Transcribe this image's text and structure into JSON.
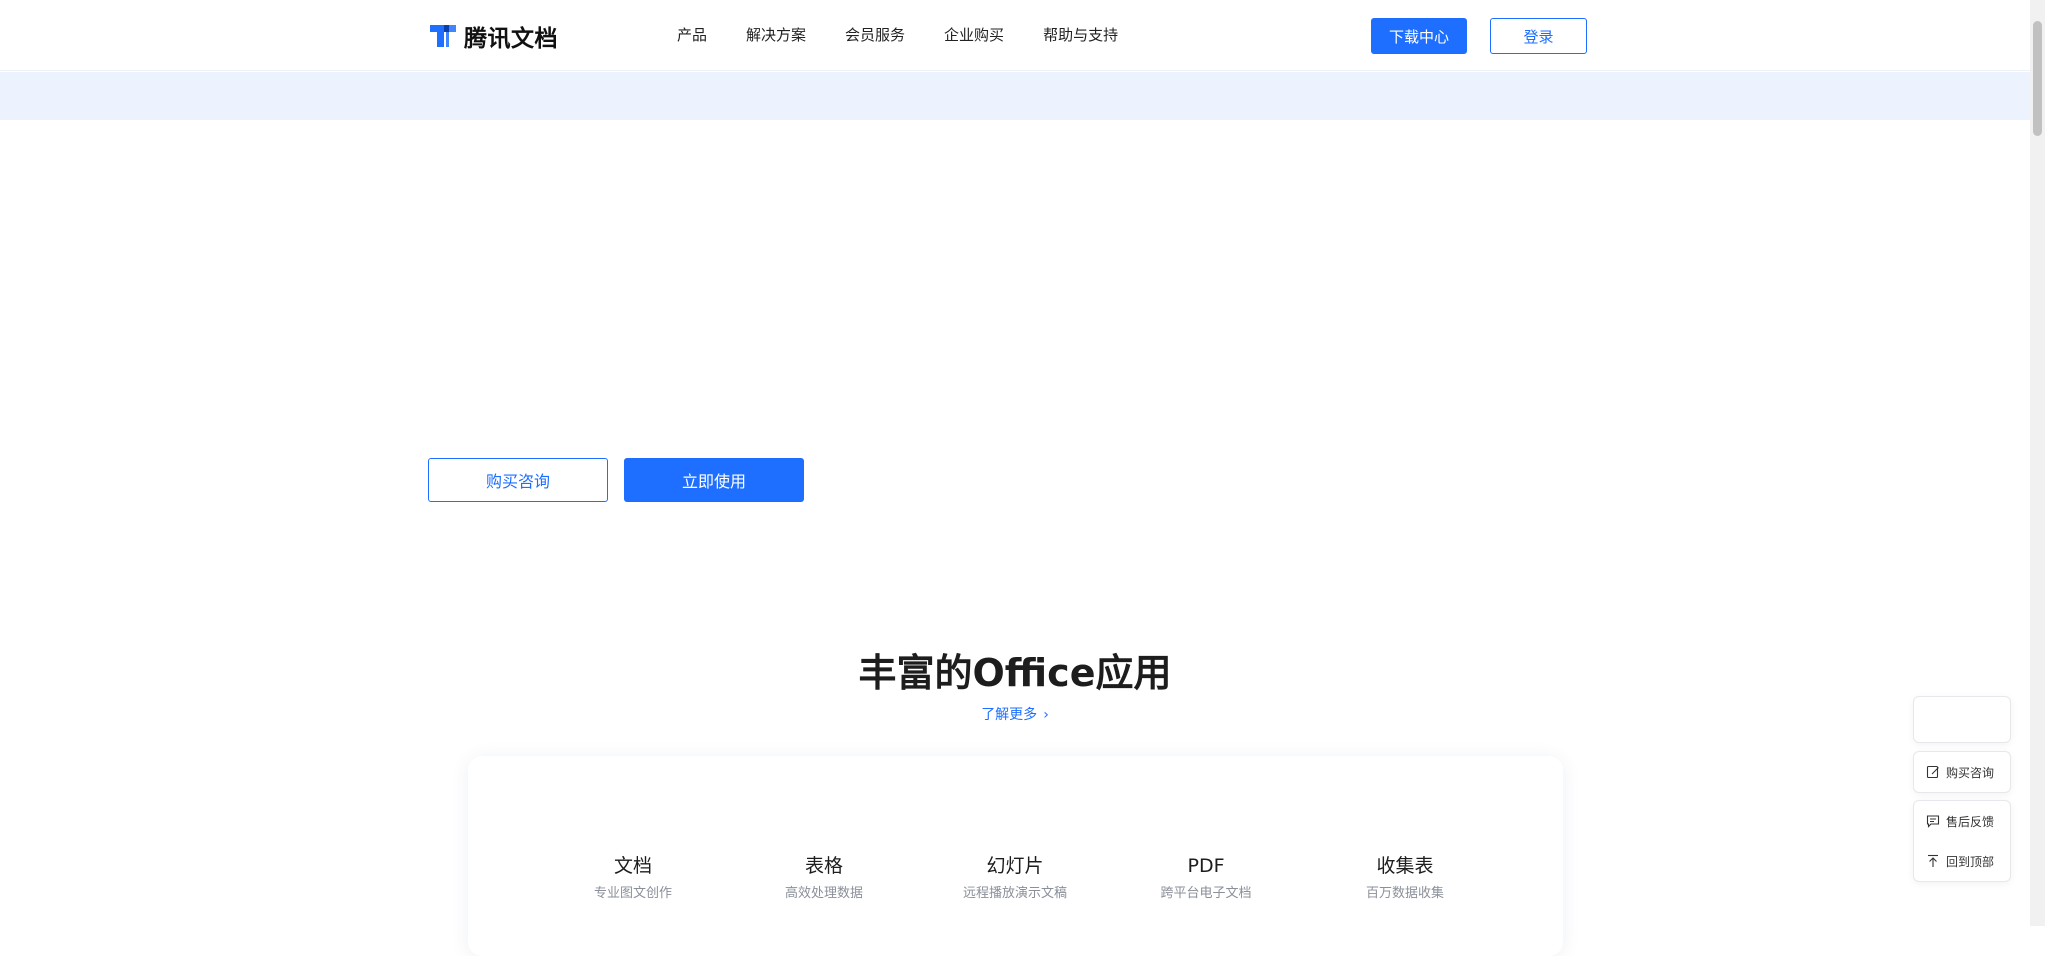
{
  "header": {
    "logo_text": "腾讯文档",
    "nav": [
      "产品",
      "解决方案",
      "会员服务",
      "企业购买",
      "帮助与支持"
    ],
    "download_label": "下载中心",
    "login_label": "登录"
  },
  "hero": {
    "consult_label": "购买咨询",
    "use_label": "立即使用"
  },
  "office": {
    "title": "丰富的Office应用",
    "learn_more": "了解更多",
    "apps": [
      {
        "name": "文档",
        "desc": "专业图文创作"
      },
      {
        "name": "表格",
        "desc": "高效处理数据"
      },
      {
        "name": "幻灯片",
        "desc": "远程播放演示文稿"
      },
      {
        "name": "PDF",
        "desc": "跨平台电子文档"
      },
      {
        "name": "收集表",
        "desc": "百万数据收集"
      }
    ]
  },
  "float_panel": {
    "consult": "购买咨询",
    "feedback": "售后反馈",
    "back_top": "回到顶部"
  },
  "colors": {
    "brand": "#1e6fff",
    "banner_bg": "#ecf3fe"
  },
  "icons": {
    "logo": "tencent-docs-logo-icon",
    "chevron": "chevron-right-icon",
    "consult": "edit-note-icon",
    "feedback": "message-icon",
    "back_top": "arrow-up-icon"
  }
}
